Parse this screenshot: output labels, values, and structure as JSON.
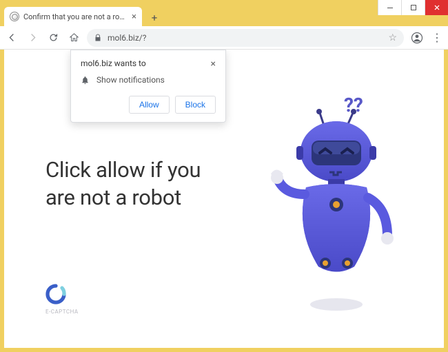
{
  "window": {
    "tab_title": "Confirm that you are not a robot",
    "url": "mol6.biz/?"
  },
  "permission": {
    "origin": "mol6.biz wants to",
    "request": "Show notifications",
    "allow_label": "Allow",
    "block_label": "Block"
  },
  "page": {
    "headline": "Click allow if you are not a robot",
    "captcha_brand": "E-CAPTCHA",
    "question_marks": "??"
  }
}
